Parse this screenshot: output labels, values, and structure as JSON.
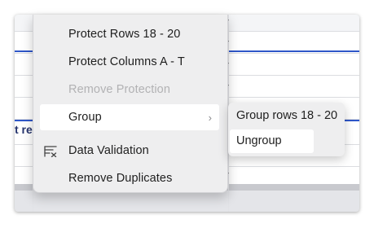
{
  "sheet": {
    "partial_cell_text": "t re"
  },
  "context_menu": {
    "items": [
      {
        "label": "Protect Rows 18 - 20",
        "enabled": true
      },
      {
        "label": "Protect Columns A - T",
        "enabled": true
      },
      {
        "label": "Remove Protection",
        "enabled": false
      },
      {
        "label": "Group",
        "enabled": true,
        "has_submenu": true,
        "submenu_icon": "chevron-right-icon"
      },
      {
        "label": "Data Validation",
        "enabled": true,
        "icon": "data-validation-icon"
      },
      {
        "label": "Remove Duplicates",
        "enabled": true
      }
    ],
    "chevron_glyph": "›"
  },
  "submenu": {
    "items": [
      {
        "label": "Group rows 18 - 20"
      },
      {
        "label": "Ungroup"
      }
    ]
  },
  "colors": {
    "selection_blue": "#2e56c8",
    "menu_bg": "#eeeeef",
    "disabled_text": "#b2b2b4"
  }
}
